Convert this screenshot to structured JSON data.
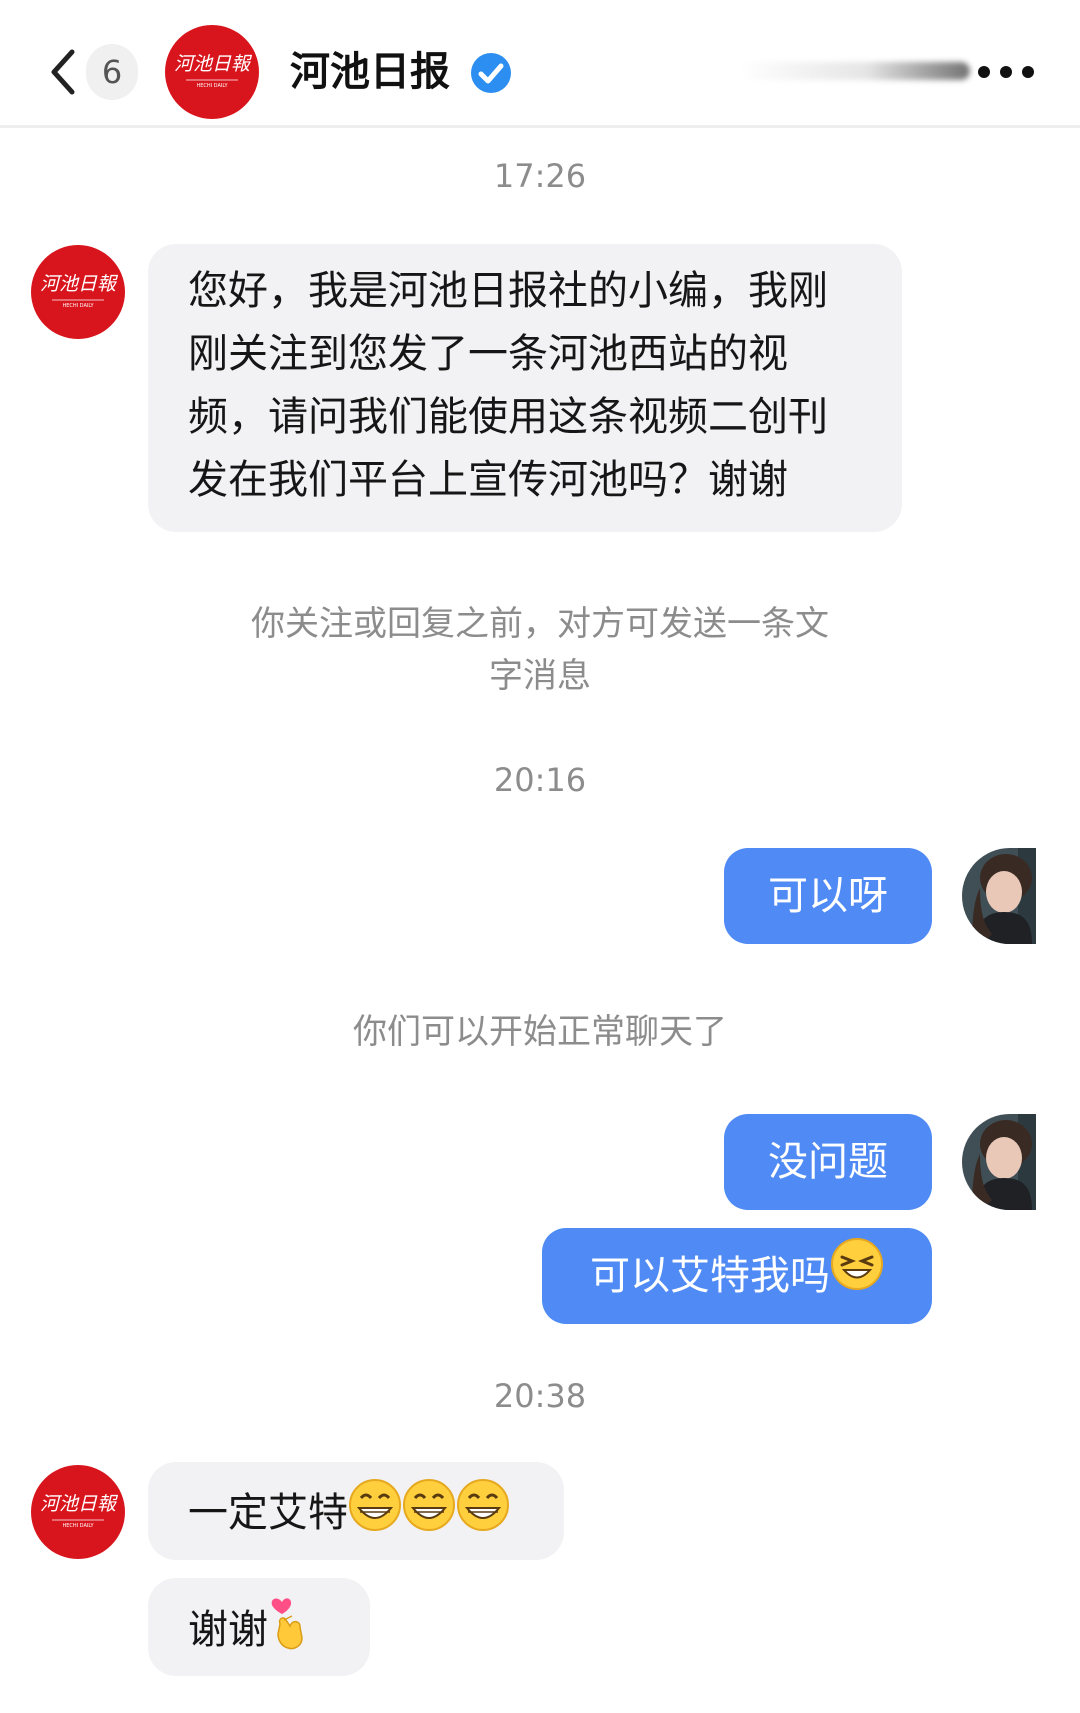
{
  "header": {
    "unread_count": "6",
    "name": "河池日报",
    "avatar_text": "河池日報",
    "avatar_subtext": "HECHI DAILY"
  },
  "messages": {
    "time1": "17:26",
    "msg1": "您好，我是河池日报社的小编，我刚刚关注到您发了一条河池西站的视频，请问我们能使用这条视频二创刊发在我们平台上宣传河池吗？谢谢",
    "msg1_lines": [
      "您好，我是河池日报社的小编，我刚",
      "刚关注到您发了一条河池西站的视",
      "频，请问我们能使用这条视频二创刊",
      "发在我们平台上宣传河池吗？谢谢"
    ],
    "notice1_lines": [
      "你关注或回复之前，对方可发送一条文",
      "字消息"
    ],
    "time2": "20:16",
    "reply1": "可以呀",
    "notice2": "你们可以开始正常聊天了",
    "reply2": "没问题",
    "reply3": "可以艾特我吗",
    "time3": "20:38",
    "msg2": "一定艾特",
    "msg3": "谢谢"
  },
  "colors": {
    "brand_red": "#d8141c",
    "bubble_blue": "#4f8af5",
    "bubble_gray": "#f2f2f4",
    "verified_blue": "#2b8ef0"
  },
  "icons": [
    "chevron-left-icon",
    "verified-check-icon",
    "more-dots-icon",
    "squint-laugh-emoji",
    "grin-emoji",
    "finger-heart-emoji"
  ]
}
